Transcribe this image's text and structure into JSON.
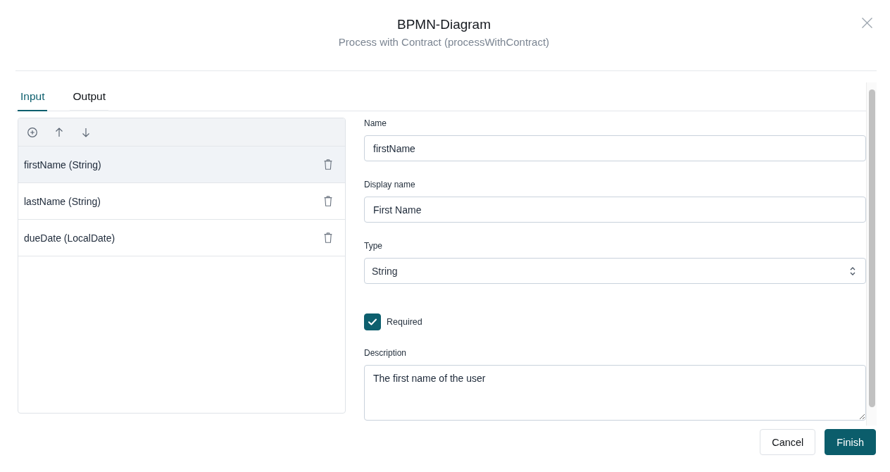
{
  "dialog": {
    "title": "BPMN-Diagram",
    "subtitle": "Process with Contract (processWithContract)"
  },
  "tabs": [
    {
      "label": "Input",
      "selected": true
    },
    {
      "label": "Output",
      "selected": false
    }
  ],
  "parameters": [
    {
      "label": "firstName (String)",
      "selected": true
    },
    {
      "label": "lastName (String)",
      "selected": false
    },
    {
      "label": "dueDate (LocalDate)",
      "selected": false
    }
  ],
  "fields": [
    {
      "kind": "text",
      "label": "Name",
      "value": "firstName"
    },
    {
      "kind": "text",
      "label": "Display name",
      "value": "First Name"
    },
    {
      "kind": "select",
      "label": "Type",
      "value": "String"
    },
    {
      "kind": "checkbox",
      "label": "Required",
      "checked": true
    },
    {
      "kind": "textarea",
      "label": "Description",
      "value": "The first name of the user"
    }
  ],
  "buttons": [
    {
      "label": "Cancel",
      "kind": "secondary"
    },
    {
      "label": "Finish",
      "kind": "primary"
    }
  ]
}
